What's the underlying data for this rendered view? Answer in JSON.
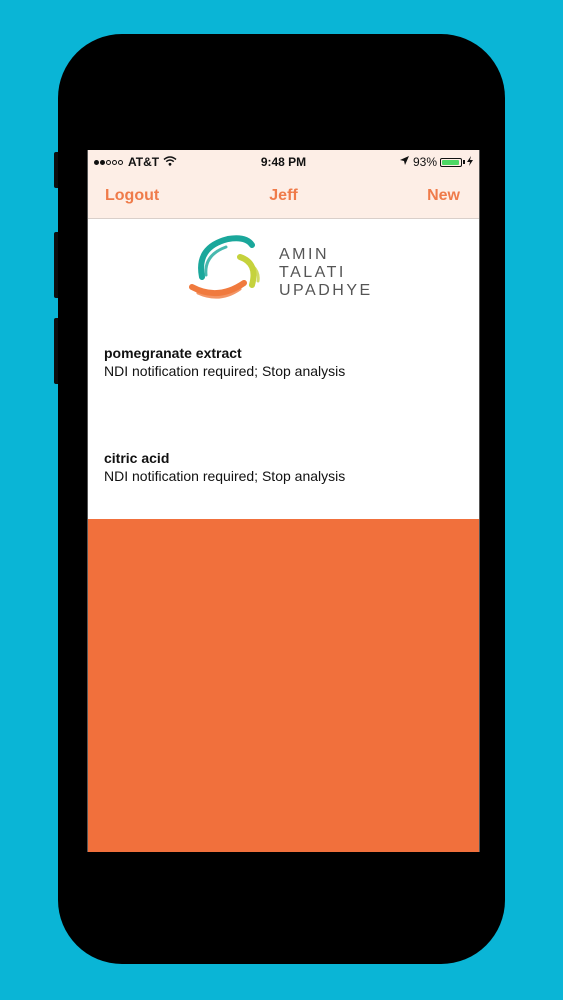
{
  "status_bar": {
    "carrier": "AT&T",
    "time": "9:48 PM",
    "battery": "93%",
    "battery_level": 0.93
  },
  "nav": {
    "left_button": "Logout",
    "title": "Jeff",
    "right_button": "New"
  },
  "logo": {
    "lines": [
      "AMIN",
      "TALATI",
      "UPADHYE"
    ]
  },
  "items": [
    {
      "name": "pomegranate extract",
      "status": "NDI notification required; Stop analysis"
    },
    {
      "name": "citric acid",
      "status": "NDI notification required; Stop analysis"
    }
  ],
  "colors": {
    "background": "#0ab5d6",
    "accent": "#ef7b4a",
    "lower_panel": "#f1703c",
    "battery_green": "#4cd964"
  },
  "icons": {
    "signal": "signal-dots-icon",
    "wifi": "wifi-icon",
    "location": "location-arrow-icon",
    "battery": "battery-icon",
    "charging": "charging-bolt-icon"
  }
}
